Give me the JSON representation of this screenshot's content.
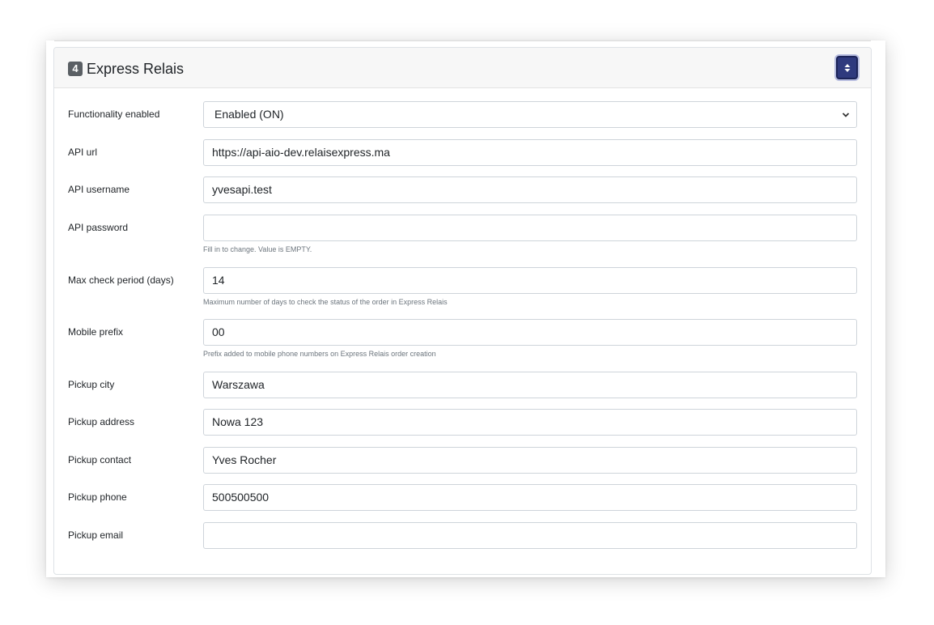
{
  "panel": {
    "badge": "4",
    "title": "Express Relais"
  },
  "fields": [
    {
      "label": "Functionality enabled",
      "value": "Enabled (ON)",
      "type": "select",
      "help": ""
    },
    {
      "label": "API url",
      "value": "https://api-aio-dev.relaisexpress.ma",
      "type": "text",
      "help": ""
    },
    {
      "label": "API username",
      "value": "yvesapi.test",
      "type": "text",
      "help": ""
    },
    {
      "label": "API password",
      "value": "",
      "type": "password",
      "help": "Fill in to change. Value is EMPTY."
    },
    {
      "label": "Max check period (days)",
      "value": "14",
      "type": "text",
      "help": "Maximum number of days to check the status of the order in Express Relais"
    },
    {
      "label": "Mobile prefix",
      "value": "00",
      "type": "text",
      "help": "Prefix added to mobile phone numbers on Express Relais order creation"
    },
    {
      "label": "Pickup city",
      "value": "Warszawa",
      "type": "text",
      "help": ""
    },
    {
      "label": "Pickup address",
      "value": "Nowa 123",
      "type": "text",
      "help": ""
    },
    {
      "label": "Pickup contact",
      "value": "Yves Rocher",
      "type": "text",
      "help": ""
    },
    {
      "label": "Pickup phone",
      "value": "500500500",
      "type": "text",
      "help": ""
    },
    {
      "label": "Pickup email",
      "value": "",
      "type": "text",
      "help": ""
    }
  ],
  "icons": {
    "sort_button": "sort-up-down-icon",
    "select_caret": "chevron-down-icon"
  },
  "colors": {
    "accent": "#2f3a7e",
    "badge": "#5a5f64",
    "help_text": "#6c757d"
  }
}
